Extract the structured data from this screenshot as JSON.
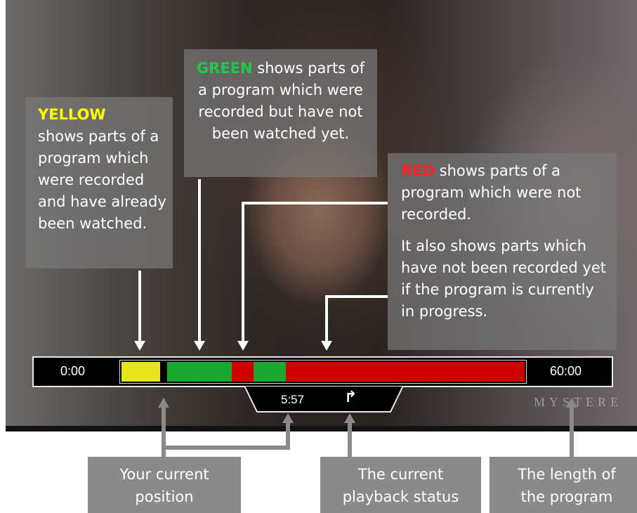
{
  "player": {
    "start_time": "0:00",
    "end_time": "60:00",
    "current_time": "5:57",
    "playback_status_icon": "redo-arrow-icon",
    "watermark": "MYSTERE",
    "segments": [
      {
        "state": "watched",
        "color": "#e6e61a"
      },
      {
        "state": "recorded-unwatched",
        "color": "#1aa830"
      },
      {
        "state": "not-recorded",
        "color": "#d00000"
      },
      {
        "state": "recorded-unwatched",
        "color": "#1aa830"
      },
      {
        "state": "not-recorded",
        "color": "#d00000"
      }
    ]
  },
  "notes": {
    "yellow": {
      "keyword": "YELLOW",
      "keyword_color": "#ffff00",
      "text": "shows parts of a program which were recorded and have already been watched."
    },
    "green": {
      "keyword": "GREEN",
      "keyword_color": "#1fc84a",
      "text": " shows parts of a program which were recorded but have not been watched yet."
    },
    "red": {
      "keyword": "RED",
      "keyword_color": "#ff2020",
      "text": " shows parts of a program which were not recorded.",
      "text2": "It also shows parts which have not been recorded yet if the program is currently in progress."
    }
  },
  "labels": {
    "position": "Your current position",
    "status": "The current playback status",
    "length": "The length of the program"
  }
}
